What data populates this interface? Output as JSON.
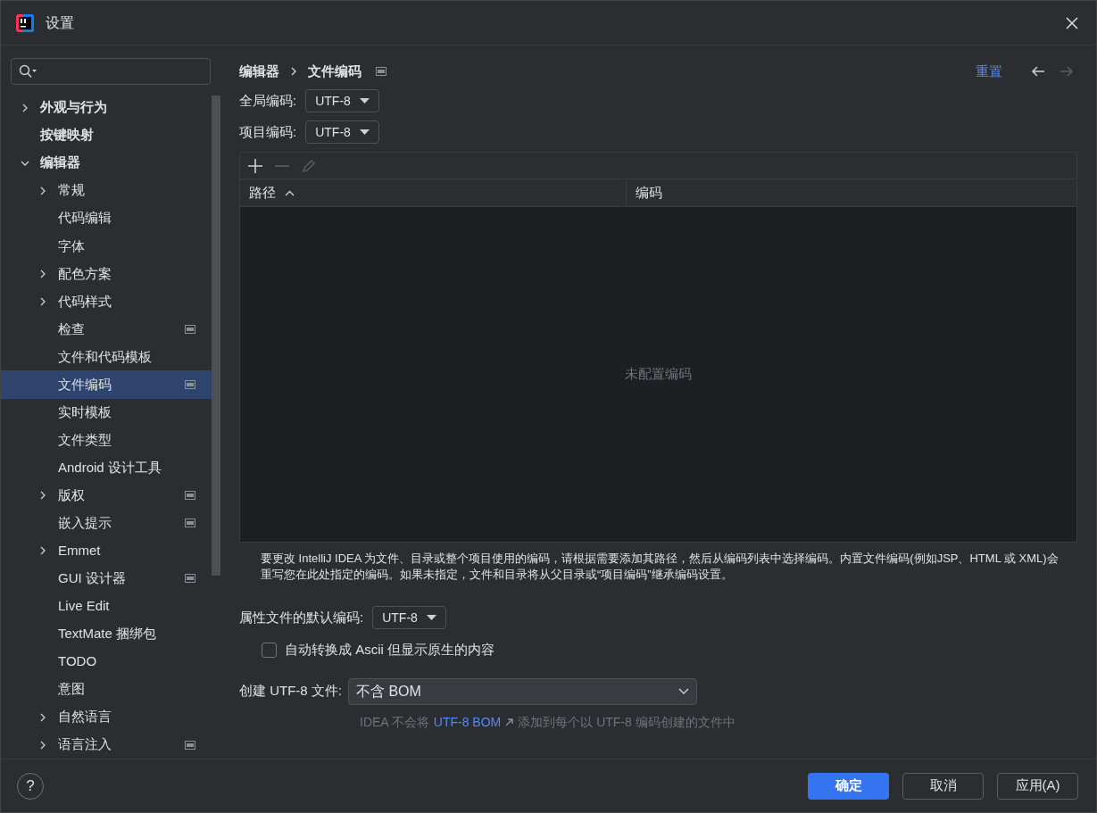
{
  "window": {
    "title": "设置"
  },
  "sidebar": {
    "items": [
      {
        "label": "外观与行为",
        "kind": "group",
        "expanded": false,
        "selected": false,
        "scope_icon": false
      },
      {
        "label": "按键映射",
        "kind": "page",
        "selected": false,
        "scope_icon": false
      },
      {
        "label": "编辑器",
        "kind": "group",
        "expanded": true,
        "selected": false,
        "scope_icon": false,
        "children": [
          {
            "label": "常规",
            "kind": "group",
            "expanded": false,
            "selected": false,
            "scope_icon": false
          },
          {
            "label": "代码编辑",
            "kind": "page",
            "selected": false,
            "scope_icon": false
          },
          {
            "label": "字体",
            "kind": "page",
            "selected": false,
            "scope_icon": false
          },
          {
            "label": "配色方案",
            "kind": "group",
            "expanded": false,
            "selected": false,
            "scope_icon": false
          },
          {
            "label": "代码样式",
            "kind": "group",
            "expanded": false,
            "selected": false,
            "scope_icon": false
          },
          {
            "label": "检查",
            "kind": "page",
            "selected": false,
            "scope_icon": true
          },
          {
            "label": "文件和代码模板",
            "kind": "page",
            "selected": false,
            "scope_icon": false
          },
          {
            "label": "文件编码",
            "kind": "page",
            "selected": true,
            "scope_icon": true
          },
          {
            "label": "实时模板",
            "kind": "page",
            "selected": false,
            "scope_icon": false
          },
          {
            "label": "文件类型",
            "kind": "page",
            "selected": false,
            "scope_icon": false
          },
          {
            "label": "Android 设计工具",
            "kind": "page",
            "selected": false,
            "scope_icon": false
          },
          {
            "label": "版权",
            "kind": "group",
            "expanded": false,
            "selected": false,
            "scope_icon": true
          },
          {
            "label": "嵌入提示",
            "kind": "page",
            "selected": false,
            "scope_icon": true
          },
          {
            "label": "Emmet",
            "kind": "group",
            "expanded": false,
            "selected": false,
            "scope_icon": false
          },
          {
            "label": "GUI 设计器",
            "kind": "page",
            "selected": false,
            "scope_icon": true
          },
          {
            "label": "Live Edit",
            "kind": "page",
            "selected": false,
            "scope_icon": false
          },
          {
            "label": "TextMate 捆绑包",
            "kind": "page",
            "selected": false,
            "scope_icon": false
          },
          {
            "label": "TODO",
            "kind": "page",
            "selected": false,
            "scope_icon": false
          },
          {
            "label": "意图",
            "kind": "page",
            "selected": false,
            "scope_icon": false
          },
          {
            "label": "自然语言",
            "kind": "group",
            "expanded": false,
            "selected": false,
            "scope_icon": false
          },
          {
            "label": "语言注入",
            "kind": "group",
            "expanded": false,
            "selected": false,
            "scope_icon": true
          }
        ]
      }
    ]
  },
  "breadcrumb": [
    "编辑器",
    "文件编码"
  ],
  "reset_link": "重置",
  "global_encoding": {
    "label": "全局编码:",
    "value": "UTF-8"
  },
  "project_encoding": {
    "label": "项目编码:",
    "value": "UTF-8"
  },
  "table": {
    "columns": [
      {
        "label": "路径",
        "sorted": true
      },
      {
        "label": "编码",
        "sorted": false
      }
    ],
    "empty_text": "未配置编码"
  },
  "hint": "要更改 IntelliJ IDEA 为文件、目录或整个项目使用的编码，请根据需要添加其路径，然后从编码列表中选择编码。内置文件编码(例如JSP、HTML 或 XML)会重写您在此处指定的编码。如果未指定，文件和目录将从父目录或“项目编码”继承编码设置。",
  "properties_encoding": {
    "label": "属性文件的默认编码:",
    "value": "UTF-8"
  },
  "transparent_ascii": {
    "label": "自动转换成 Ascii 但显示原生的内容",
    "checked": false
  },
  "create_utf8": {
    "label": "创建 UTF-8 文件:",
    "value": "不含 BOM"
  },
  "bom_note": {
    "before": "IDEA 不会将",
    "link": "UTF-8 BOM",
    "after": "添加到每个以 UTF-8 编码创建的文件中"
  },
  "help": "?",
  "buttons": [
    {
      "label": "确定",
      "primary": true
    },
    {
      "label": "取消",
      "primary": false
    },
    {
      "label": "应用(A)",
      "primary": false
    }
  ]
}
